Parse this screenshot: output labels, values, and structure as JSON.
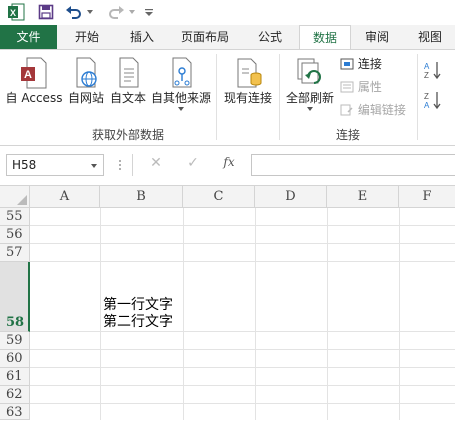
{
  "titlebar": {
    "app_icon": "excel-logo",
    "undo_icon": "undo-arrow",
    "redo_icon": "redo-arrow",
    "save_icon": "floppy-disk",
    "customize_icon": "dropdown-caret"
  },
  "tabs": [
    {
      "label": "文件"
    },
    {
      "label": "开始"
    },
    {
      "label": "插入"
    },
    {
      "label": "页面布局"
    },
    {
      "label": "公式"
    },
    {
      "label": "数据"
    },
    {
      "label": "审阅"
    },
    {
      "label": "视图"
    }
  ],
  "ribbon": {
    "get_external": {
      "group_label": "获取外部数据",
      "buttons": [
        {
          "label": "自 Access"
        },
        {
          "label": "自网站"
        },
        {
          "label": "自文本"
        },
        {
          "label": "自其他来源"
        }
      ]
    },
    "existing": {
      "label": "现有连接"
    },
    "connections": {
      "group_label": "连接",
      "refresh_all": "全部刷新",
      "items": [
        {
          "label": "连接"
        },
        {
          "label": "属性"
        },
        {
          "label": "编辑链接"
        }
      ]
    },
    "sort": {
      "asc": "A↓Z",
      "desc": "Z↓A"
    }
  },
  "formula_bar": {
    "name_box": "H58",
    "cancel": "✕",
    "enter": "✓",
    "fx": "fx",
    "value": ""
  },
  "grid": {
    "columns": [
      "A",
      "B",
      "C",
      "D",
      "E",
      "F"
    ],
    "rows": [
      "55",
      "56",
      "57",
      "58",
      "59",
      "60",
      "61",
      "62",
      "63"
    ],
    "selected_row": "58",
    "cell_B58_line1": "第一行文字",
    "cell_B58_line2": "第二行文字"
  },
  "colors": {
    "accent": "#217346",
    "header_bg": "#f3f3f3"
  }
}
